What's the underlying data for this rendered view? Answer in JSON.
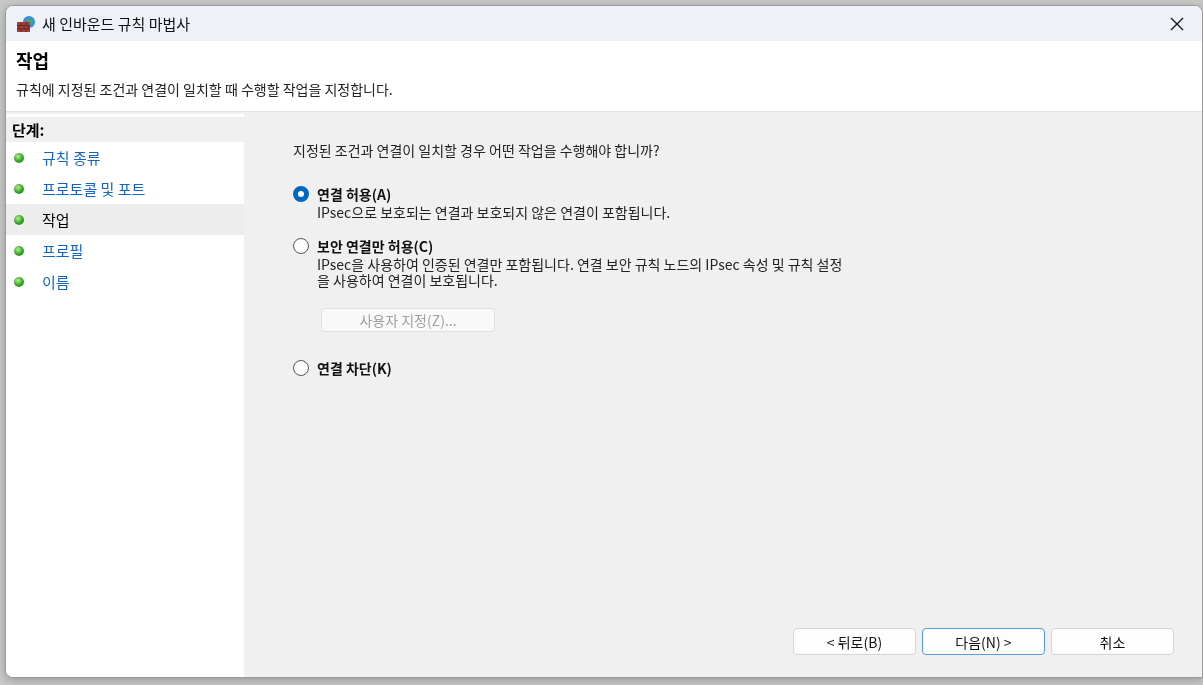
{
  "window": {
    "title": "새 인바운드 규칙 마법사"
  },
  "header": {
    "title": "작업",
    "description": "규칙에 지정된 조건과 연결이 일치할 때 수행할 작업을 지정합니다."
  },
  "steps": {
    "heading": "단계:",
    "items": [
      {
        "label": "규칙 종류",
        "selected": false
      },
      {
        "label": "프로토콜 및 포트",
        "selected": false
      },
      {
        "label": "작업",
        "selected": true
      },
      {
        "label": "프로필",
        "selected": false
      },
      {
        "label": "이름",
        "selected": false
      }
    ]
  },
  "content": {
    "question": "지정된 조건과 연결이 일치할 경우 어떤 작업을 수행해야 합니까?",
    "options": [
      {
        "label": "연결 허용(A)",
        "selected": true,
        "description": "IPsec으로 보호되는 연결과 보호되지 않은 연결이 포함됩니다."
      },
      {
        "label": "보안 연결만 허용(C)",
        "selected": false,
        "description": "IPsec을 사용하여 인증된 연결만 포함됩니다. 연결 보안 규칙 노드의 IPsec 속성 및 규칙 설정을 사용하여 연결이 보호됩니다.",
        "button": {
          "label": "사용자 지정(Z)...",
          "disabled": true
        }
      },
      {
        "label": "연결 차단(K)",
        "selected": false
      }
    ]
  },
  "buttons": [
    {
      "label": "< 뒤로(B)",
      "default": false
    },
    {
      "label": "다음(N) >",
      "default": true
    },
    {
      "label": "취소",
      "default": false
    }
  ]
}
